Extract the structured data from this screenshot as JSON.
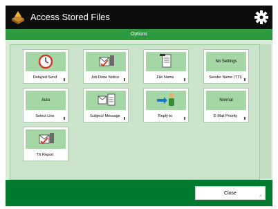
{
  "app": {
    "title": "Access Stored Files"
  },
  "header": {
    "options_label": "Options"
  },
  "buttons": {
    "delayed_send": {
      "label": "Delayed Send"
    },
    "job_done_notice": {
      "label": "Job Done Notice"
    },
    "file_name": {
      "label": "File Name"
    },
    "sender_name": {
      "status": "No Settings",
      "label": "Sender Name (TTI)"
    },
    "select_line": {
      "status": "Auto",
      "label": "Select Line"
    },
    "subject_message": {
      "label": "Subject/ Message"
    },
    "reply_to": {
      "label": "Reply-to"
    },
    "email_priority": {
      "status": "Normal",
      "label": "E-Mail Priority"
    },
    "tx_report": {
      "label": "TX Report"
    }
  },
  "footer": {
    "close_label": "Close"
  },
  "colors": {
    "header": "#0d0d0d",
    "accent_green": "#2e9a3f",
    "footer_green": "#007a2e",
    "icon_tile": "#a5d6a5",
    "panel": "#cce4cc"
  }
}
